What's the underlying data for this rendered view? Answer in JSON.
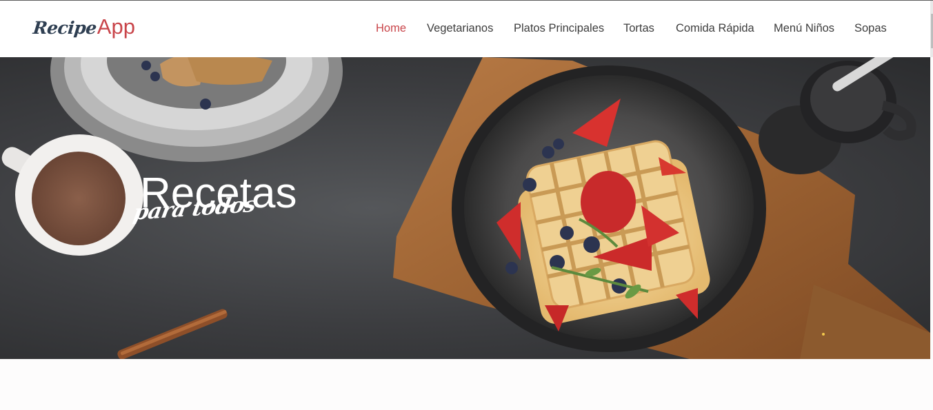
{
  "brand": {
    "part1": "Recipe",
    "part2": "App",
    "accent_color": "#c9454a",
    "dark_color": "#2f3f52"
  },
  "nav": {
    "items": [
      {
        "label": "Home",
        "active": true
      },
      {
        "label": "Vegetarianos",
        "active": false
      },
      {
        "label": "Platos Principales",
        "active": false
      },
      {
        "label": "Tortas",
        "active": false
      },
      {
        "label": "Comida Rápida",
        "active": false
      },
      {
        "label": "Menú Niños",
        "active": false
      },
      {
        "label": "Sopas",
        "active": false
      }
    ]
  },
  "hero": {
    "title": "Recetas",
    "subtitle": "para todos",
    "image_description_icons": [
      "coffee-cup-icon",
      "waffle-plate-icon",
      "cutting-board-icon",
      "syrup-pitcher-icon",
      "cinnamon-stick-icon",
      "bread-plate-icon"
    ]
  },
  "colors": {
    "hero_bg": "#3c3d40",
    "nav_text": "#3d3d3d",
    "carousel_dot": "#f2c94c"
  }
}
